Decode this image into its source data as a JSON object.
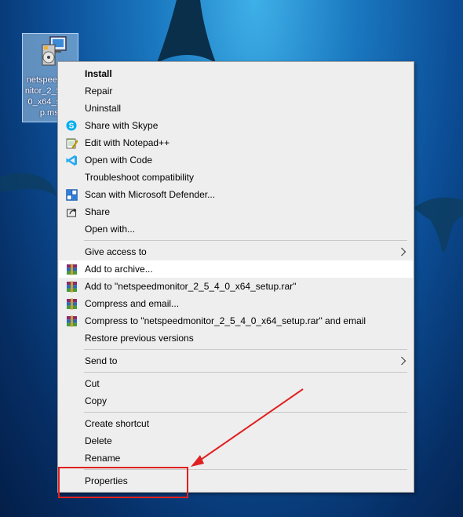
{
  "desktop_icon": {
    "label": "netspeedmonitor_2_5_4_0_x64_setup.msi"
  },
  "context_menu": {
    "items": [
      {
        "label": "Install",
        "bold": true,
        "icon": ""
      },
      {
        "label": "Repair",
        "icon": ""
      },
      {
        "label": "Uninstall",
        "icon": ""
      },
      {
        "label": "Share with Skype",
        "icon": "skype-icon"
      },
      {
        "label": "Edit with Notepad++",
        "icon": "notepad-plus-plus-icon"
      },
      {
        "label": "Open with Code",
        "icon": "vscode-icon"
      },
      {
        "label": "Troubleshoot compatibility",
        "icon": ""
      },
      {
        "label": "Scan with Microsoft Defender...",
        "icon": "defender-icon"
      },
      {
        "label": "Share",
        "icon": "share-icon"
      },
      {
        "label": "Open with...",
        "icon": ""
      },
      {
        "label": "Give access to",
        "icon": "",
        "submenu": true
      },
      {
        "label": "Add to archive...",
        "icon": "winrar-icon"
      },
      {
        "label": "Add to \"netspeedmonitor_2_5_4_0_x64_setup.rar\"",
        "icon": "winrar-icon"
      },
      {
        "label": "Compress and email...",
        "icon": "winrar-icon"
      },
      {
        "label": "Compress to \"netspeedmonitor_2_5_4_0_x64_setup.rar\" and email",
        "icon": "winrar-icon"
      },
      {
        "label": "Restore previous versions",
        "icon": ""
      },
      {
        "label": "Send to",
        "icon": "",
        "submenu": true
      },
      {
        "label": "Cut",
        "icon": ""
      },
      {
        "label": "Copy",
        "icon": ""
      },
      {
        "label": "Create shortcut",
        "icon": ""
      },
      {
        "label": "Delete",
        "icon": ""
      },
      {
        "label": "Rename",
        "icon": ""
      },
      {
        "label": "Properties",
        "icon": ""
      }
    ]
  },
  "colors": {
    "annotation": "#e02020",
    "menu_bg": "#eeeeee",
    "hover_bg": "#ffffff"
  }
}
